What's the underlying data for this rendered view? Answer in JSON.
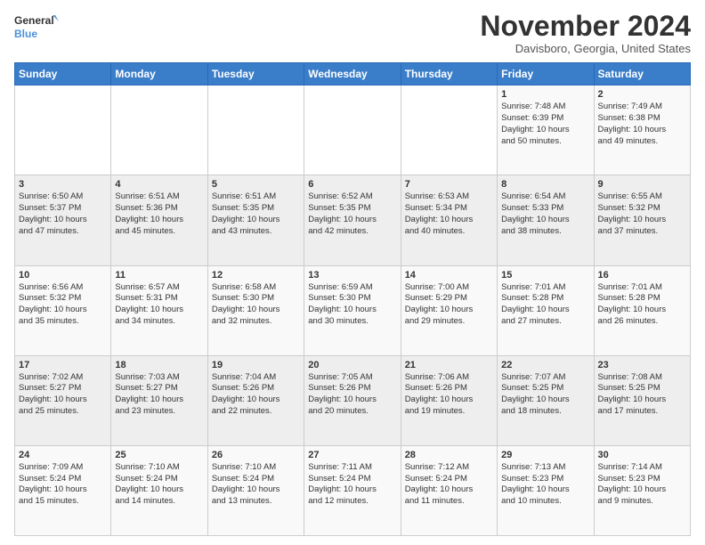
{
  "header": {
    "logo_line1": "General",
    "logo_line2": "Blue",
    "month": "November 2024",
    "location": "Davisboro, Georgia, United States"
  },
  "days_of_week": [
    "Sunday",
    "Monday",
    "Tuesday",
    "Wednesday",
    "Thursday",
    "Friday",
    "Saturday"
  ],
  "weeks": [
    [
      {
        "day": "",
        "info": ""
      },
      {
        "day": "",
        "info": ""
      },
      {
        "day": "",
        "info": ""
      },
      {
        "day": "",
        "info": ""
      },
      {
        "day": "",
        "info": ""
      },
      {
        "day": "1",
        "info": "Sunrise: 7:48 AM\nSunset: 6:39 PM\nDaylight: 10 hours\nand 50 minutes."
      },
      {
        "day": "2",
        "info": "Sunrise: 7:49 AM\nSunset: 6:38 PM\nDaylight: 10 hours\nand 49 minutes."
      }
    ],
    [
      {
        "day": "3",
        "info": "Sunrise: 6:50 AM\nSunset: 5:37 PM\nDaylight: 10 hours\nand 47 minutes."
      },
      {
        "day": "4",
        "info": "Sunrise: 6:51 AM\nSunset: 5:36 PM\nDaylight: 10 hours\nand 45 minutes."
      },
      {
        "day": "5",
        "info": "Sunrise: 6:51 AM\nSunset: 5:35 PM\nDaylight: 10 hours\nand 43 minutes."
      },
      {
        "day": "6",
        "info": "Sunrise: 6:52 AM\nSunset: 5:35 PM\nDaylight: 10 hours\nand 42 minutes."
      },
      {
        "day": "7",
        "info": "Sunrise: 6:53 AM\nSunset: 5:34 PM\nDaylight: 10 hours\nand 40 minutes."
      },
      {
        "day": "8",
        "info": "Sunrise: 6:54 AM\nSunset: 5:33 PM\nDaylight: 10 hours\nand 38 minutes."
      },
      {
        "day": "9",
        "info": "Sunrise: 6:55 AM\nSunset: 5:32 PM\nDaylight: 10 hours\nand 37 minutes."
      }
    ],
    [
      {
        "day": "10",
        "info": "Sunrise: 6:56 AM\nSunset: 5:32 PM\nDaylight: 10 hours\nand 35 minutes."
      },
      {
        "day": "11",
        "info": "Sunrise: 6:57 AM\nSunset: 5:31 PM\nDaylight: 10 hours\nand 34 minutes."
      },
      {
        "day": "12",
        "info": "Sunrise: 6:58 AM\nSunset: 5:30 PM\nDaylight: 10 hours\nand 32 minutes."
      },
      {
        "day": "13",
        "info": "Sunrise: 6:59 AM\nSunset: 5:30 PM\nDaylight: 10 hours\nand 30 minutes."
      },
      {
        "day": "14",
        "info": "Sunrise: 7:00 AM\nSunset: 5:29 PM\nDaylight: 10 hours\nand 29 minutes."
      },
      {
        "day": "15",
        "info": "Sunrise: 7:01 AM\nSunset: 5:28 PM\nDaylight: 10 hours\nand 27 minutes."
      },
      {
        "day": "16",
        "info": "Sunrise: 7:01 AM\nSunset: 5:28 PM\nDaylight: 10 hours\nand 26 minutes."
      }
    ],
    [
      {
        "day": "17",
        "info": "Sunrise: 7:02 AM\nSunset: 5:27 PM\nDaylight: 10 hours\nand 25 minutes."
      },
      {
        "day": "18",
        "info": "Sunrise: 7:03 AM\nSunset: 5:27 PM\nDaylight: 10 hours\nand 23 minutes."
      },
      {
        "day": "19",
        "info": "Sunrise: 7:04 AM\nSunset: 5:26 PM\nDaylight: 10 hours\nand 22 minutes."
      },
      {
        "day": "20",
        "info": "Sunrise: 7:05 AM\nSunset: 5:26 PM\nDaylight: 10 hours\nand 20 minutes."
      },
      {
        "day": "21",
        "info": "Sunrise: 7:06 AM\nSunset: 5:26 PM\nDaylight: 10 hours\nand 19 minutes."
      },
      {
        "day": "22",
        "info": "Sunrise: 7:07 AM\nSunset: 5:25 PM\nDaylight: 10 hours\nand 18 minutes."
      },
      {
        "day": "23",
        "info": "Sunrise: 7:08 AM\nSunset: 5:25 PM\nDaylight: 10 hours\nand 17 minutes."
      }
    ],
    [
      {
        "day": "24",
        "info": "Sunrise: 7:09 AM\nSunset: 5:24 PM\nDaylight: 10 hours\nand 15 minutes."
      },
      {
        "day": "25",
        "info": "Sunrise: 7:10 AM\nSunset: 5:24 PM\nDaylight: 10 hours\nand 14 minutes."
      },
      {
        "day": "26",
        "info": "Sunrise: 7:10 AM\nSunset: 5:24 PM\nDaylight: 10 hours\nand 13 minutes."
      },
      {
        "day": "27",
        "info": "Sunrise: 7:11 AM\nSunset: 5:24 PM\nDaylight: 10 hours\nand 12 minutes."
      },
      {
        "day": "28",
        "info": "Sunrise: 7:12 AM\nSunset: 5:24 PM\nDaylight: 10 hours\nand 11 minutes."
      },
      {
        "day": "29",
        "info": "Sunrise: 7:13 AM\nSunset: 5:23 PM\nDaylight: 10 hours\nand 10 minutes."
      },
      {
        "day": "30",
        "info": "Sunrise: 7:14 AM\nSunset: 5:23 PM\nDaylight: 10 hours\nand 9 minutes."
      }
    ]
  ]
}
